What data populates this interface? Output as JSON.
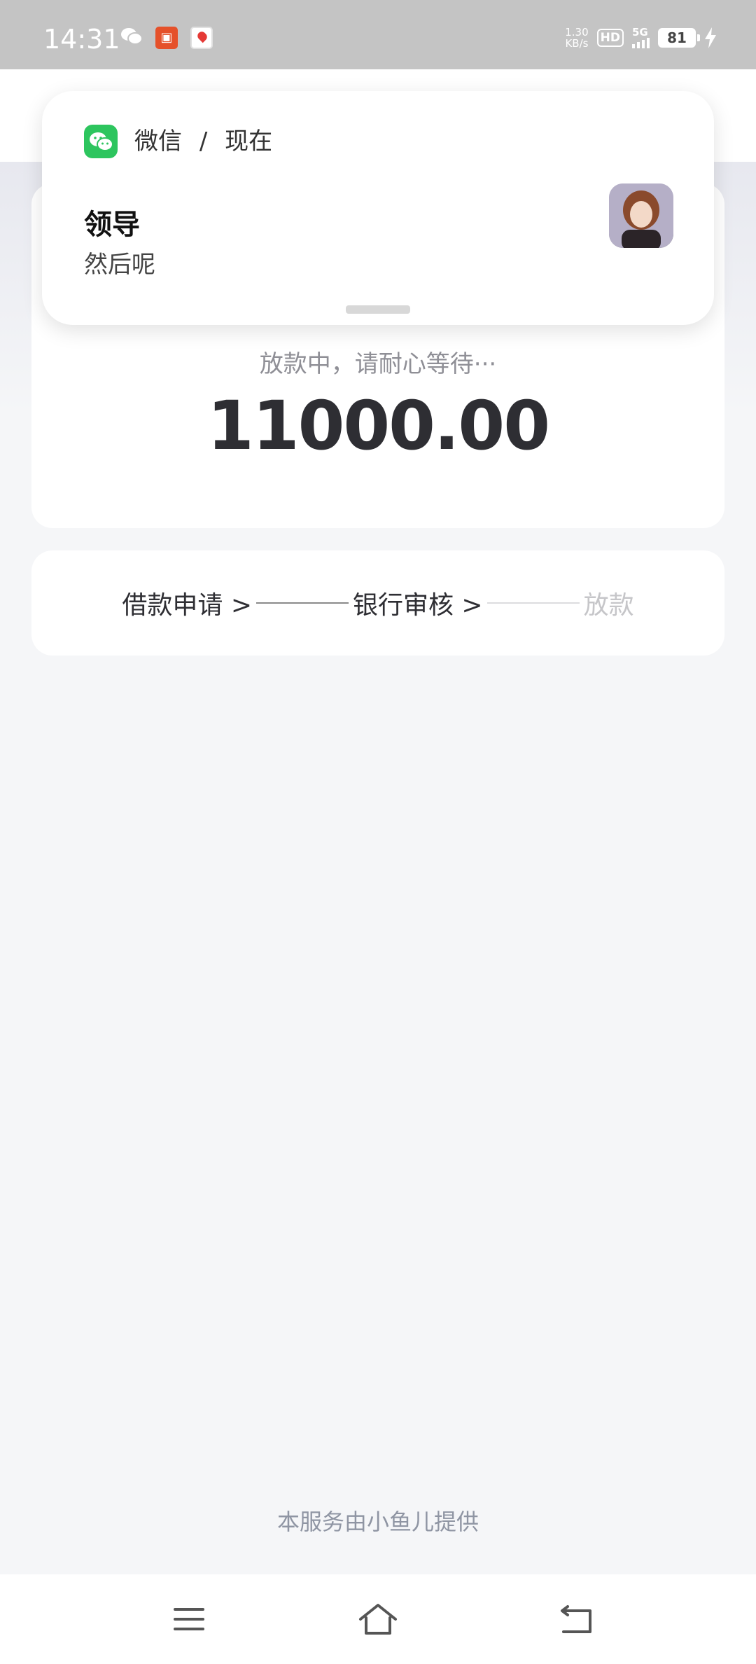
{
  "status_bar": {
    "time": "14:31",
    "net_speed_value": "1.30",
    "net_speed_unit": "KB/s",
    "hd_label": "HD",
    "network_label": "5G",
    "battery_level": "81"
  },
  "notification": {
    "app_name": "微信",
    "separator": "/",
    "time": "现在",
    "sender": "领导",
    "message": "然后呢"
  },
  "loan": {
    "status_text": "放款中，请耐心等待···",
    "amount": "11000.00"
  },
  "progress": {
    "steps": [
      "借款申请 >",
      "银行审核 >",
      "放款"
    ],
    "current_step_index": 1
  },
  "footer": {
    "provider_text": "本服务由小鱼儿提供"
  },
  "colors": {
    "wechat_green": "#2dc55e",
    "text_primary": "#2e2e33",
    "text_muted": "#8f8f96",
    "step_inactive": "#c6c6c9"
  }
}
